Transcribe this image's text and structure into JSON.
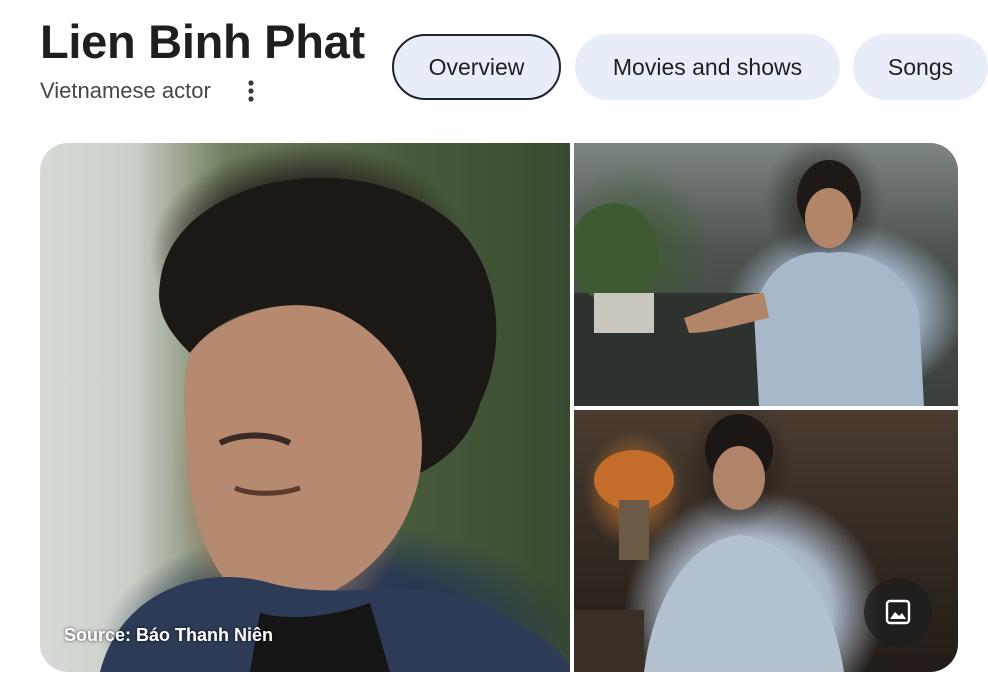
{
  "header": {
    "title": "Lien Binh Phat",
    "subtitle": "Vietnamese actor"
  },
  "tabs": [
    {
      "label": "Overview",
      "active": true
    },
    {
      "label": "Movies and shows",
      "active": false
    },
    {
      "label": "Songs",
      "active": false
    }
  ],
  "gallery": {
    "source_text": "Source: Báo Thanh Niên",
    "more_icon": "more-vert-icon",
    "image_icon": "image-icon"
  },
  "colors": {
    "tab_background": "#e8eef9",
    "active_tab_border": "#1f2430",
    "title_text": "#1f1f1f"
  }
}
